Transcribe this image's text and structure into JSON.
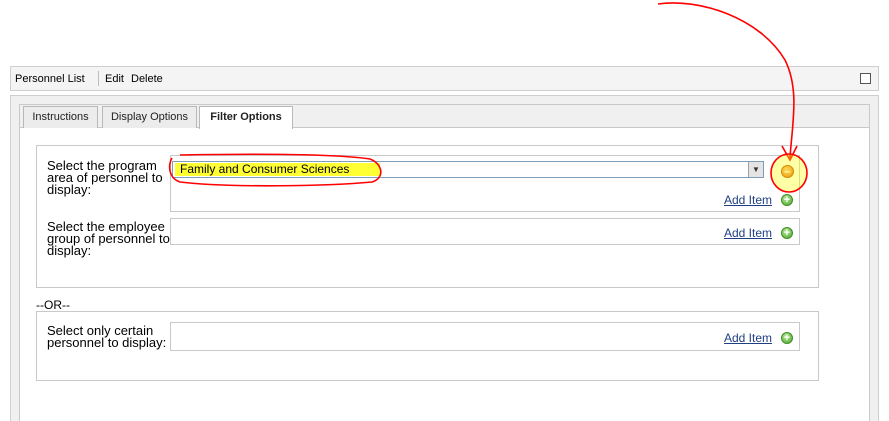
{
  "header": {
    "title": "Personnel List",
    "edit_label": "Edit",
    "delete_label": "Delete"
  },
  "tabs": [
    {
      "label": "Instructions",
      "active": false
    },
    {
      "label": "Display Options",
      "active": false
    },
    {
      "label": "Filter Options",
      "active": true
    }
  ],
  "filters": {
    "program_area": {
      "label": "Select the program area of personnel to display:",
      "selected_value": "Family and Consumer Sciences",
      "add_label": "Add Item"
    },
    "employee_group": {
      "label": "Select the employee group of personnel to display:",
      "add_label": "Add Item"
    },
    "or_text": "--OR--",
    "personnel": {
      "label": "Select only certain personnel to display:",
      "add_label": "Add Item"
    }
  },
  "icons": {
    "add": "plus-circle-icon",
    "remove": "minus-circle-icon",
    "dropdown": "chevron-down-icon"
  },
  "colors": {
    "highlight": "#ffff33",
    "annotation": "#ff0000",
    "link": "#1f3f82",
    "add_icon": "#4aa52b",
    "remove_icon": "#e2640f"
  }
}
